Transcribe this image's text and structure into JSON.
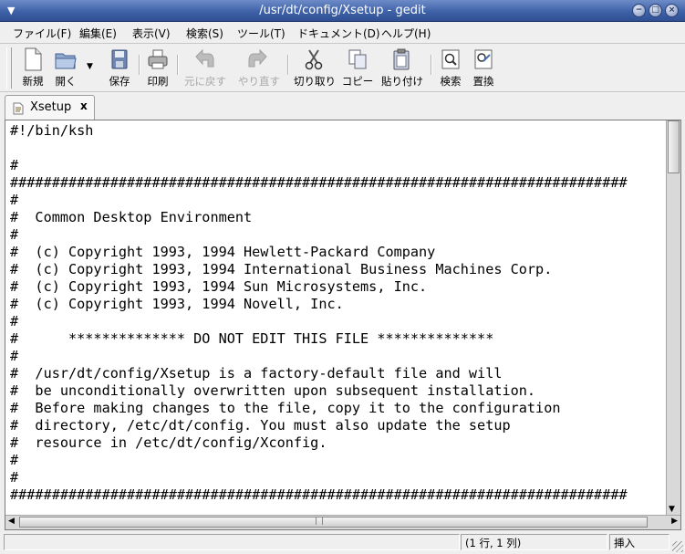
{
  "window": {
    "title": "/usr/dt/config/Xsetup - gedit",
    "menu_icon": "window-menu-arrow-icon",
    "controls": [
      "minimize-icon",
      "maximize-icon",
      "close-icon"
    ]
  },
  "menubar": {
    "items": [
      {
        "label": "ファイル(F)"
      },
      {
        "label": "編集(E)"
      },
      {
        "label": "表示(V)"
      },
      {
        "label": "検索(S)"
      },
      {
        "label": "ツール(T)"
      },
      {
        "label": "ドキュメント(D)"
      },
      {
        "label": "ヘルプ(H)"
      }
    ]
  },
  "toolbar": {
    "new_label": "新規",
    "open_label": "開く",
    "save_label": "保存",
    "print_label": "印刷",
    "undo_label": "元に戻す",
    "redo_label": "やり直す",
    "cut_label": "切り取り",
    "copy_label": "コピー",
    "paste_label": "貼り付け",
    "find_label": "検索",
    "replace_label": "置換"
  },
  "tabs": [
    {
      "label": "Xsetup",
      "close": "x",
      "active": true
    }
  ],
  "editor": {
    "lines": [
      "#!/bin/ksh",
      "",
      "#",
      "##########################################################################",
      "#",
      "#  Common Desktop Environment",
      "#",
      "#  (c) Copyright 1993, 1994 Hewlett-Packard Company",
      "#  (c) Copyright 1993, 1994 International Business Machines Corp.",
      "#  (c) Copyright 1993, 1994 Sun Microsystems, Inc.",
      "#  (c) Copyright 1993, 1994 Novell, Inc.",
      "#",
      "#      ************** DO NOT EDIT THIS FILE **************",
      "#",
      "#  /usr/dt/config/Xsetup is a factory-default file and will",
      "#  be unconditionally overwritten upon subsequent installation.",
      "#  Before making changes to the file, copy it to the configuration",
      "#  directory, /etc/dt/config. You must also update the setup",
      "#  resource in /etc/dt/config/Xconfig.",
      "#",
      "#",
      "##########################################################################"
    ]
  },
  "statusbar": {
    "position": "(1 行, 1 列)",
    "mode": "挿入"
  },
  "colors": {
    "titlebar": "#3f62a8",
    "background": "#efefef",
    "editor_bg": "#ffffff"
  }
}
